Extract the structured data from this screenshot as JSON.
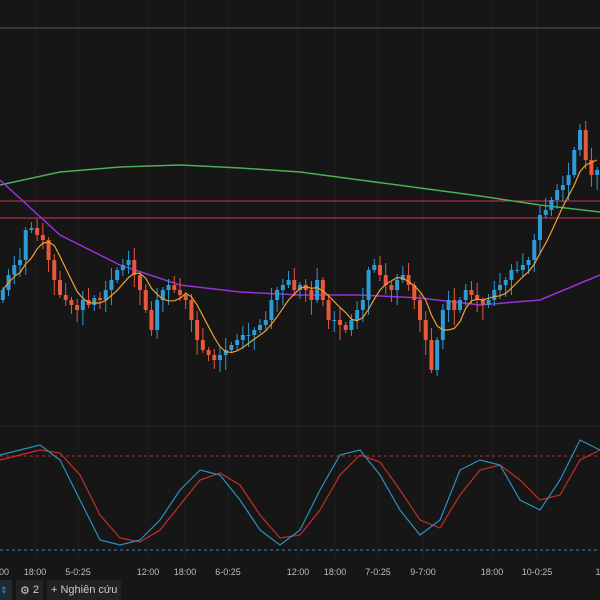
{
  "chart_data": {
    "type": "candlestick",
    "closes": [
      210,
      225,
      235,
      240,
      270,
      272,
      265,
      260,
      240,
      220,
      205,
      200,
      195,
      190,
      200,
      195,
      202,
      200,
      210,
      220,
      230,
      235,
      240,
      225,
      210,
      190,
      170,
      200,
      210,
      215,
      210,
      205,
      200,
      180,
      160,
      150,
      145,
      140,
      145,
      150,
      155,
      160,
      165,
      165,
      170,
      175,
      180,
      200,
      210,
      215,
      220,
      210,
      215,
      210,
      200,
      220,
      200,
      180,
      180,
      175,
      170,
      180,
      190,
      200,
      230,
      235,
      225,
      215,
      210,
      220,
      225,
      215,
      200,
      180,
      160,
      130,
      160,
      190,
      200,
      190,
      200,
      210,
      205,
      200,
      195,
      200,
      210,
      215,
      220,
      230,
      230,
      235,
      240,
      260,
      285,
      290,
      300,
      310,
      315,
      325,
      350,
      370,
      340,
      325,
      330
    ],
    "ma_long": [
      315,
      328,
      333,
      335,
      332,
      328,
      320,
      312,
      304,
      295,
      288
    ],
    "ma_slow": [
      320,
      265,
      235,
      215,
      208,
      205,
      205,
      202,
      195,
      200,
      225
    ],
    "levels": [
      299,
      282
    ],
    "oscillator": {
      "k": [
        95,
        100,
        105,
        90,
        50,
        10,
        5,
        10,
        30,
        60,
        80,
        75,
        50,
        20,
        5,
        20,
        60,
        95,
        100,
        75,
        40,
        15,
        30,
        80,
        90,
        85,
        50,
        40,
        70,
        110,
        100
      ],
      "d": [
        90,
        95,
        100,
        97,
        75,
        35,
        12,
        8,
        20,
        45,
        70,
        77,
        65,
        35,
        12,
        15,
        40,
        75,
        95,
        88,
        60,
        30,
        22,
        55,
        80,
        85,
        70,
        50,
        55,
        90,
        100
      ]
    },
    "x_ticks": [
      "00",
      "18:00",
      "5-0:25",
      "12:00",
      "18:00",
      "6-0:25",
      "12:00",
      "18:00",
      "7-0:25",
      "9-7:00",
      "18:00",
      "10-0:25",
      "1"
    ]
  },
  "colors": {
    "up": "#2e9ad6",
    "down": "#e8583a",
    "ma_fast": "#f0a030",
    "ma_slow": "#9b30d9",
    "ma_long": "#4caf50",
    "level": "#c8365a",
    "k": "#2e8fc0",
    "d": "#c0302a"
  },
  "toolbar": {
    "settings_count": "2",
    "research_label": "+ Nghiên cứu"
  }
}
